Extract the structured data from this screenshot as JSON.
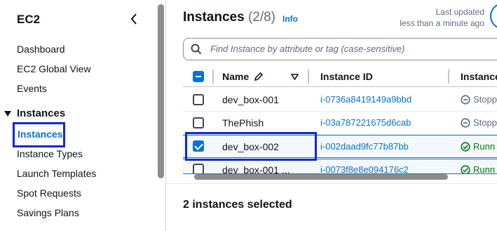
{
  "sidebar": {
    "title": "EC2",
    "items": [
      {
        "label": "Dashboard"
      },
      {
        "label": "EC2 Global View"
      },
      {
        "label": "Events"
      }
    ],
    "section": {
      "label": "Instances",
      "items": [
        {
          "label": "Instances",
          "active": true
        },
        {
          "label": "Instance Types"
        },
        {
          "label": "Launch Templates"
        },
        {
          "label": "Spot Requests"
        },
        {
          "label": "Savings Plans"
        }
      ]
    }
  },
  "header": {
    "title": "Instances",
    "count": "(2/8)",
    "info": "Info",
    "last_updated_line1": "Last updated",
    "last_updated_line2": "less than a minute ago"
  },
  "search": {
    "placeholder": "Find Instance by attribute or tag (case-sensitive)"
  },
  "table": {
    "columns": [
      "Name",
      "Instance ID",
      "Instance"
    ],
    "rows": [
      {
        "name": "dev_box-001",
        "instance_id": "i-0736a8419149a9bbd",
        "state": "Stopp",
        "state_icon": "stopped-icon",
        "checked": false
      },
      {
        "name": "ThePhish",
        "instance_id": "i-03a787221675d6cab",
        "state": "Stopp",
        "state_icon": "stopped-icon",
        "checked": false
      },
      {
        "name": "dev_box-002",
        "instance_id": "i-002daad9fc77b87bb",
        "state": "Runn",
        "state_icon": "running-icon",
        "checked": true
      },
      {
        "name": "dev_box-001 ...",
        "instance_id": "i-0073f8e8e094176c2",
        "state": "Runn",
        "state_icon": "running-icon",
        "checked": true
      }
    ]
  },
  "footer": {
    "selected_text": "2 instances selected"
  },
  "colors": {
    "link": "#0972d3",
    "highlight_border": "#0d2ad0",
    "running": "#037f0c",
    "stopped": "#5f6b7a"
  }
}
